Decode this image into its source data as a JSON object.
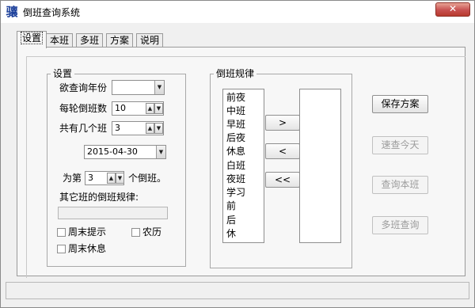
{
  "window": {
    "title": "倒班查询系统",
    "close_label": "✕",
    "app_icon_glyph": "骧"
  },
  "tabs": [
    {
      "label": "设置",
      "active": true
    },
    {
      "label": "本班",
      "active": false
    },
    {
      "label": "多班",
      "active": false
    },
    {
      "label": "方案",
      "active": false
    },
    {
      "label": "说明",
      "active": false
    }
  ],
  "settings": {
    "legend": "设置",
    "query_year_label": "欲查询年份",
    "query_year_value": "",
    "shifts_per_cycle_label": "每轮倒班数",
    "shifts_per_cycle_value": "10",
    "total_shifts_label": "共有几个班",
    "total_shifts_value": "3",
    "date_value": "2015-04-30",
    "as_shift_prefix": "为第",
    "as_shift_value": "3",
    "as_shift_suffix": "个倒班。",
    "other_rule_label": "其它班的倒班规律:",
    "other_rule_value": "",
    "weekend_reminder_label": "周末提示",
    "lunar_label": "农历",
    "weekend_rest_label": "周末休息"
  },
  "rules": {
    "legend": "倒班规律",
    "source_items": [
      "前夜",
      "中班",
      "早班",
      "后夜",
      "休息",
      "白班",
      "夜班",
      "学习",
      "前",
      "后",
      "休"
    ],
    "target_items": [],
    "add_button": ">",
    "remove_button": "<",
    "clear_button": "<<"
  },
  "actions": {
    "save_scheme": "保存方案",
    "query_today": "速查今天",
    "query_this_shift": "查询本班",
    "query_multi_shift": "多班查询"
  }
}
